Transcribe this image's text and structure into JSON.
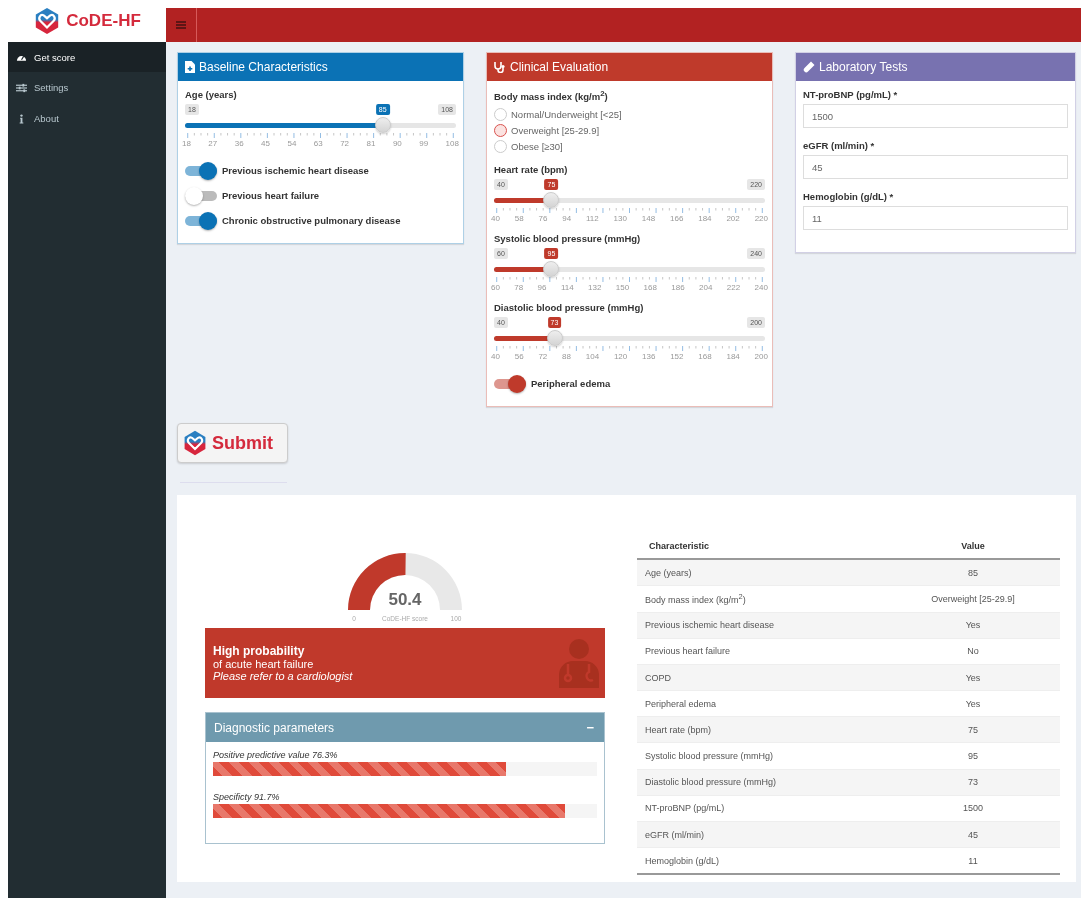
{
  "app": {
    "logo_text": "CoDE-HF"
  },
  "sidebar": {
    "items": [
      {
        "label": "Get score",
        "selected": true
      },
      {
        "label": "Settings",
        "selected": false
      },
      {
        "label": "About",
        "selected": false
      }
    ]
  },
  "boxes": [
    {
      "title": "Baseline Characteristics",
      "color": "#0b72b5",
      "fields": [
        {
          "kind": "slider",
          "label": "Age (years)",
          "min": "18",
          "max": "108",
          "value": "85",
          "level": 0.744,
          "ticks": [
            "18",
            "27",
            "36",
            "45",
            "54",
            "63",
            "72",
            "81",
            "90",
            "99",
            "108"
          ]
        },
        {
          "kind": "toggle",
          "label": "Previous ischemic heart disease",
          "on": true
        },
        {
          "kind": "toggle",
          "label": "Previous heart failure",
          "on": false
        },
        {
          "kind": "toggle",
          "label": "Chronic obstructive pulmonary disease",
          "on": true
        }
      ]
    },
    {
      "title": "Clinical Evaluation",
      "color": "#bf3a2b",
      "fields": [
        {
          "kind": "radio",
          "label": "Body mass index (kg/m$^{2}$)",
          "options": [
            {
              "label": "Normal/Underweight [<25]",
              "selected": false
            },
            {
              "label": "Overweight [25-29.9]",
              "selected": true
            },
            {
              "label": "Obese [≥30]",
              "selected": false
            }
          ]
        },
        {
          "kind": "slider",
          "label": "Heart rate (bpm)",
          "min": "40",
          "max": "220",
          "value": "75",
          "level": 0.194,
          "ticks": [
            "40",
            "58",
            "76",
            "94",
            "112",
            "130",
            "148",
            "166",
            "184",
            "202",
            "220"
          ]
        },
        {
          "kind": "slider",
          "label": "Systolic blood pressure (mmHg)",
          "min": "60",
          "max": "240",
          "value": "95",
          "level": 0.194,
          "ticks": [
            "60",
            "78",
            "96",
            "114",
            "132",
            "150",
            "168",
            "186",
            "204",
            "222",
            "240"
          ]
        },
        {
          "kind": "slider",
          "label": "Diastolic blood pressure (mmHg)",
          "min": "40",
          "max": "200",
          "value": "73",
          "level": 0.206,
          "ticks": [
            "40",
            "56",
            "72",
            "88",
            "104",
            "120",
            "136",
            "152",
            "168",
            "184",
            "200"
          ]
        },
        {
          "kind": "toggle",
          "label": "Peripheral edema",
          "on": true
        }
      ]
    },
    {
      "title": "Laboratory Tests",
      "color": "#7872b0",
      "fields": [
        {
          "kind": "input",
          "label": "NT-proBNP (pg/mL) *",
          "value": "1500"
        },
        {
          "kind": "input",
          "label": "eGFR (ml/min) *",
          "value": "45"
        },
        {
          "kind": "input",
          "label": "Hemoglobin (g/dL) *",
          "value": "11"
        }
      ]
    }
  ],
  "submit": {
    "label": "Submit"
  },
  "result": {
    "gauge": {
      "value": "50.4",
      "min_label": "0",
      "caption": "CoDE-HF score",
      "max_label": "100"
    },
    "alert": {
      "title": "High probability",
      "line": "of acute heart failure",
      "note": "Please refer to a cardiologist"
    },
    "diagnostic": {
      "title": "Diagnostic parameters",
      "collapse": "−",
      "bars": [
        {
          "label": "Positive predictive value 76.3%",
          "level": 0.763
        },
        {
          "label": "Specificty 91.7%",
          "level": 0.917
        }
      ]
    },
    "table": {
      "columns": [
        "Characteristic",
        "Value"
      ],
      "rows": [
        [
          "Age (years)",
          "85"
        ],
        [
          "Body mass index (kg/m$^{2}$)",
          "Overweight [25-29.9]"
        ],
        [
          "Previous ischemic heart disease",
          "Yes"
        ],
        [
          "Previous heart failure",
          "No"
        ],
        [
          "COPD",
          "Yes"
        ],
        [
          "Peripheral edema",
          "Yes"
        ],
        [
          "Heart rate (bpm)",
          "75"
        ],
        [
          "Systolic blood pressure (mmHg)",
          "95"
        ],
        [
          "Diastolic blood pressure (mmHg)",
          "73"
        ],
        [
          "NT-proBNP (pg/mL)",
          "1500"
        ],
        [
          "eGFR (ml/min)",
          "45"
        ],
        [
          "Hemoglobin (g/dL)",
          "11"
        ]
      ]
    }
  }
}
